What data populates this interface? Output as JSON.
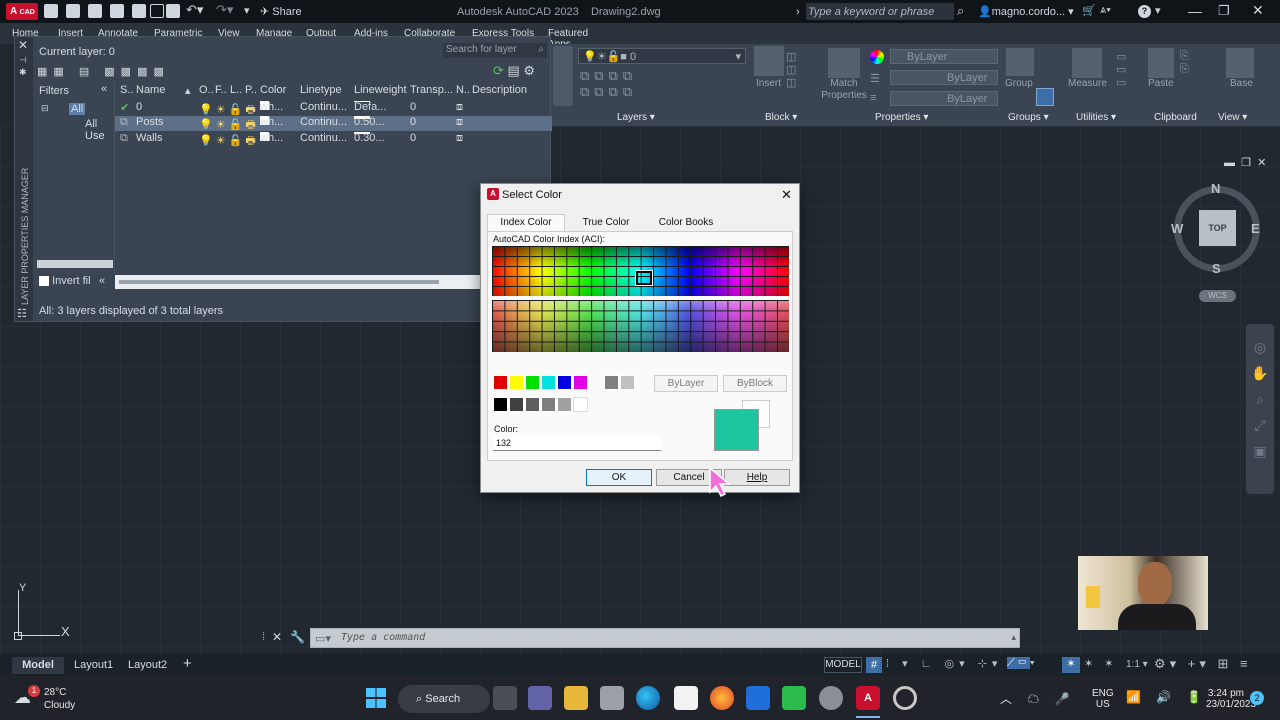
{
  "app": {
    "badge": "A",
    "badge_sub": "CAD",
    "title": "Autodesk AutoCAD 2023",
    "filename": "Drawing2.dwg",
    "share": "Share",
    "search_placeholder": "Type a keyword or phrase",
    "user": "magno.cordo...",
    "help": "?"
  },
  "ribbon_tabs": [
    "Home",
    "Insert",
    "Annotate",
    "Parametric",
    "View",
    "Manage",
    "Output",
    "Add-ins",
    "Collaborate",
    "Express Tools",
    "Featured Apps"
  ],
  "ribbon": {
    "layer_value": "0",
    "insert": "Insert",
    "match_properties": "Match Properties",
    "bylayer1": "ByLayer",
    "bylayer2": "ByLayer",
    "bylayer3": "ByLayer",
    "group": "Group",
    "measure": "Measure",
    "paste": "Paste",
    "base": "Base",
    "panels": [
      "Layers",
      "Block",
      "Properties",
      "Groups",
      "Utilities",
      "Clipboard",
      "View"
    ]
  },
  "layer_palette": {
    "current_layer": "Current layer: 0",
    "search_placeholder": "Search for layer",
    "filters_label": "Filters",
    "tree_all": "All",
    "tree_all_used": "All Use",
    "invert_filter": "Invert fil",
    "status": "All: 3 layers displayed of 3 total layers",
    "side_title": "LAYER PROPERTIES MANAGER",
    "columns": [
      "S..",
      "Name",
      "O..",
      "F..",
      "L..",
      "P..",
      "Color",
      "Linetype",
      "Lineweight",
      "Transp...",
      "N..",
      "Description"
    ],
    "rows": [
      {
        "name": "0",
        "color": "wh...",
        "linetype": "Continu...",
        "lineweight": "Defa...",
        "transparency": "0"
      },
      {
        "name": "Posts",
        "color": "wh...",
        "linetype": "Continu...",
        "lineweight": "0.50...",
        "transparency": "0"
      },
      {
        "name": "Walls",
        "color": "wh...",
        "linetype": "Continu...",
        "lineweight": "0.30...",
        "transparency": "0"
      }
    ]
  },
  "dialog": {
    "title": "Select Color",
    "close": "✕",
    "tabs": [
      "Index Color",
      "True Color",
      "Color Books"
    ],
    "aci_label": "AutoCAD Color Index (ACI):",
    "bylayer": "ByLayer",
    "byblock": "ByBlock",
    "color_label": "Color:",
    "color_value": "132",
    "ok": "OK",
    "cancel": "Cancel",
    "help": "Help",
    "preview_color": "#1fc4a0"
  },
  "viewcube": {
    "n": "N",
    "s": "S",
    "e": "E",
    "w": "W",
    "top": "TOP",
    "wcs": "WCS"
  },
  "command": {
    "placeholder": "Type a command"
  },
  "status_tabs": [
    "Model",
    "Layout1",
    "Layout2",
    "+"
  ],
  "statusbar": {
    "model": "MODEL",
    "scale": "1:1"
  },
  "taskbar": {
    "weather_temp": "28°C",
    "weather_desc": "Cloudy",
    "weather_badge": "1",
    "search": "Search",
    "lang1": "ENG",
    "lang2": "US",
    "time": "3:24 pm",
    "date": "23/01/2023",
    "notif": "2"
  },
  "ucs": {
    "x": "X",
    "y": "Y"
  }
}
